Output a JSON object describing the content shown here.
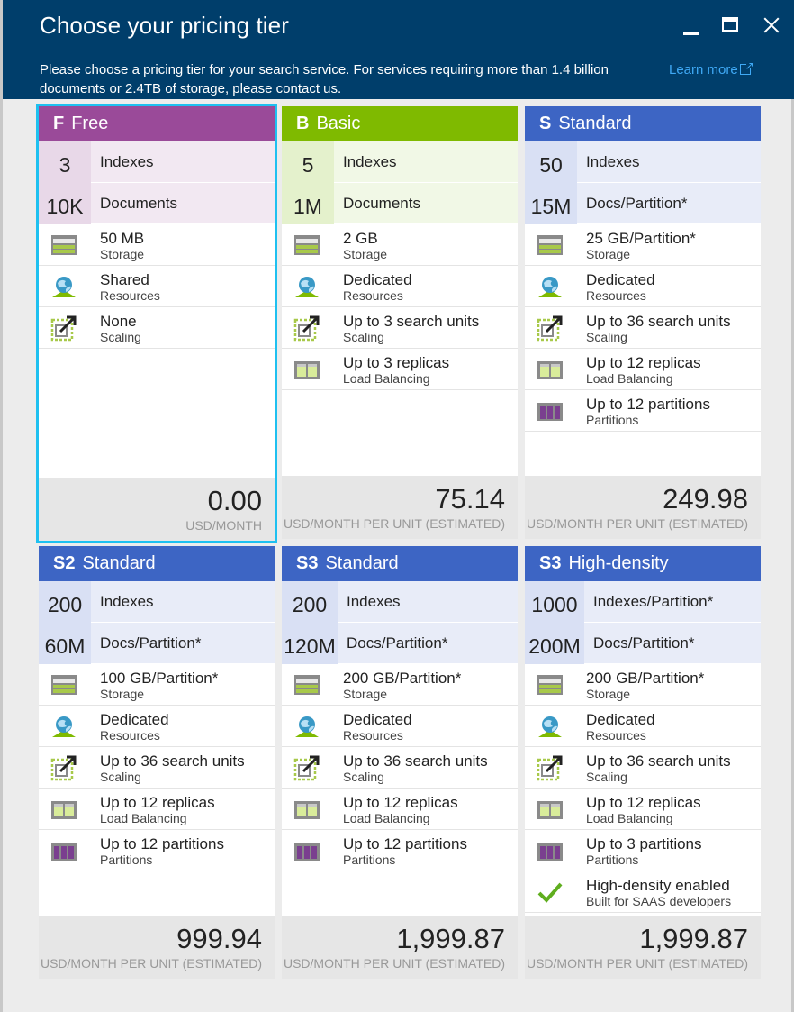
{
  "header": {
    "title": "Choose your pricing tier",
    "description": "Please choose a pricing tier for your search service. For services requiring more than 1.4 billion documents or 2.4TB of storage, please contact us.",
    "learn_more": "Learn more"
  },
  "colors": {
    "header_bg": "#003e6b",
    "free": "#9a4a99",
    "basic": "#7fba00",
    "standard": "#3d65c4",
    "selected_outline": "#1ec0f0",
    "link": "#3fa9f5"
  },
  "tiers": [
    {
      "code": "F",
      "name": "Free",
      "big": [
        {
          "num": "3",
          "label": "Indexes"
        },
        {
          "num": "10K",
          "label": "Documents"
        }
      ],
      "features": [
        {
          "icon": "storage-icon",
          "main": "50 MB",
          "sub": "Storage"
        },
        {
          "icon": "resources-icon",
          "main": "Shared",
          "sub": "Resources"
        },
        {
          "icon": "scaling-icon",
          "main": "None",
          "sub": "Scaling"
        }
      ],
      "price": "0.00",
      "unit": "USD/MONTH"
    },
    {
      "code": "B",
      "name": "Basic",
      "big": [
        {
          "num": "5",
          "label": "Indexes"
        },
        {
          "num": "1M",
          "label": "Documents"
        }
      ],
      "features": [
        {
          "icon": "storage-icon",
          "main": "2 GB",
          "sub": "Storage"
        },
        {
          "icon": "resources-icon",
          "main": "Dedicated",
          "sub": "Resources"
        },
        {
          "icon": "scaling-icon",
          "main": "Up to 3 search units",
          "sub": "Scaling"
        },
        {
          "icon": "replicas-icon",
          "main": "Up to 3 replicas",
          "sub": "Load Balancing"
        }
      ],
      "price": "75.14",
      "unit": "USD/MONTH PER UNIT (ESTIMATED)"
    },
    {
      "code": "S",
      "name": "Standard",
      "big": [
        {
          "num": "50",
          "label": "Indexes"
        },
        {
          "num": "15M",
          "label": "Docs/Partition*"
        }
      ],
      "features": [
        {
          "icon": "storage-icon",
          "main": "25 GB/Partition*",
          "sub": "Storage"
        },
        {
          "icon": "resources-icon",
          "main": "Dedicated",
          "sub": "Resources"
        },
        {
          "icon": "scaling-icon",
          "main": "Up to 36 search units",
          "sub": "Scaling"
        },
        {
          "icon": "replicas-icon",
          "main": "Up to 12 replicas",
          "sub": "Load Balancing"
        },
        {
          "icon": "partitions-icon",
          "main": "Up to 12 partitions",
          "sub": "Partitions"
        }
      ],
      "price": "249.98",
      "unit": "USD/MONTH PER UNIT (ESTIMATED)"
    },
    {
      "code": "S2",
      "name": "Standard",
      "big": [
        {
          "num": "200",
          "label": "Indexes"
        },
        {
          "num": "60M",
          "label": "Docs/Partition*"
        }
      ],
      "features": [
        {
          "icon": "storage-icon",
          "main": "100 GB/Partition*",
          "sub": "Storage"
        },
        {
          "icon": "resources-icon",
          "main": "Dedicated",
          "sub": "Resources"
        },
        {
          "icon": "scaling-icon",
          "main": "Up to 36 search units",
          "sub": "Scaling"
        },
        {
          "icon": "replicas-icon",
          "main": "Up to 12 replicas",
          "sub": "Load Balancing"
        },
        {
          "icon": "partitions-icon",
          "main": "Up to 12 partitions",
          "sub": "Partitions"
        }
      ],
      "price": "999.94",
      "unit": "USD/MONTH PER UNIT (ESTIMATED)"
    },
    {
      "code": "S3",
      "name": "Standard",
      "big": [
        {
          "num": "200",
          "label": "Indexes"
        },
        {
          "num": "120M",
          "label": "Docs/Partition*"
        }
      ],
      "features": [
        {
          "icon": "storage-icon",
          "main": "200 GB/Partition*",
          "sub": "Storage"
        },
        {
          "icon": "resources-icon",
          "main": "Dedicated",
          "sub": "Resources"
        },
        {
          "icon": "scaling-icon",
          "main": "Up to 36 search units",
          "sub": "Scaling"
        },
        {
          "icon": "replicas-icon",
          "main": "Up to 12 replicas",
          "sub": "Load Balancing"
        },
        {
          "icon": "partitions-icon",
          "main": "Up to 12 partitions",
          "sub": "Partitions"
        }
      ],
      "price": "1,999.87",
      "unit": "USD/MONTH PER UNIT (ESTIMATED)"
    },
    {
      "code": "S3",
      "name": "High-density",
      "big": [
        {
          "num": "1000",
          "label": "Indexes/Partition*"
        },
        {
          "num": "200M",
          "label": "Docs/Partition*"
        }
      ],
      "features": [
        {
          "icon": "storage-icon",
          "main": "200 GB/Partition*",
          "sub": "Storage"
        },
        {
          "icon": "resources-icon",
          "main": "Dedicated",
          "sub": "Resources"
        },
        {
          "icon": "scaling-icon",
          "main": "Up to 36 search units",
          "sub": "Scaling"
        },
        {
          "icon": "replicas-icon",
          "main": "Up to 12 replicas",
          "sub": "Load Balancing"
        },
        {
          "icon": "partitions-icon",
          "main": "Up to 3 partitions",
          "sub": "Partitions"
        },
        {
          "icon": "checkmark-icon",
          "main": "High-density enabled",
          "sub": "Built for SAAS developers"
        }
      ],
      "price": "1,999.87",
      "unit": "USD/MONTH PER UNIT (ESTIMATED)"
    }
  ]
}
